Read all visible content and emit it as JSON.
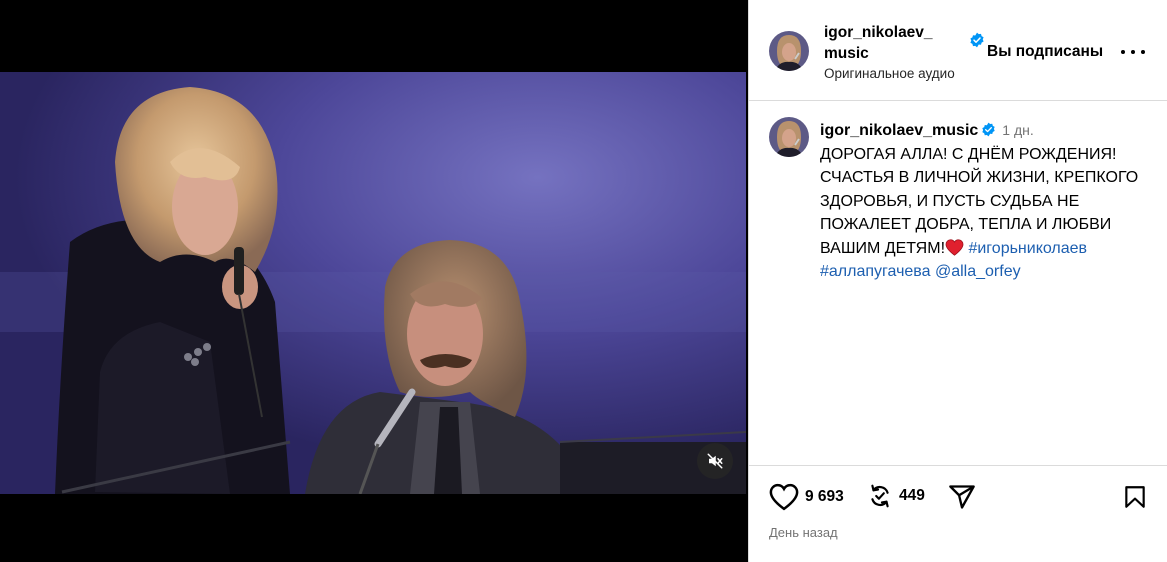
{
  "post": {
    "author": "igor_nikolaev_music",
    "follow_status": "Вы подписаны",
    "audio_label": "Оригинальное аудио",
    "caption": {
      "author": "igor_nikolaev_music",
      "timestamp": "1 дн.",
      "text": "ДОРОГАЯ АЛЛА! С ДНЁМ РОЖДЕНИЯ! СЧАСТЬЯ В ЛИЧНОЙ ЖИЗНИ, КРЕПКОГО ЗДОРОВЬЯ, И ПУСТЬ СУДЬБА НЕ ПОЖАЛЕЕТ ДОБРА, ТЕПЛА И ЛЮБВИ ВАШИМ ДЕТЯМ!",
      "hashtag_1": "#игорьниколаев",
      "hashtag_2": "#аллапугачева",
      "mention": "@alla_orfey"
    },
    "likes": "9 693",
    "reposts": "449",
    "date_label": "День назад"
  },
  "icons": {
    "verified": "verified-badge-icon",
    "more": "more-options-icon",
    "mute": "muted-speaker-icon",
    "like": "heart-icon",
    "repost": "repost-icon",
    "share": "paper-plane-icon",
    "save": "bookmark-icon",
    "emoji": "red-heart-emoji"
  },
  "colors": {
    "verified_blue": "#0095f6",
    "hashtag_blue": "#1d5fb0",
    "secondary_text": "#737373",
    "divider": "#dbdbdb"
  }
}
